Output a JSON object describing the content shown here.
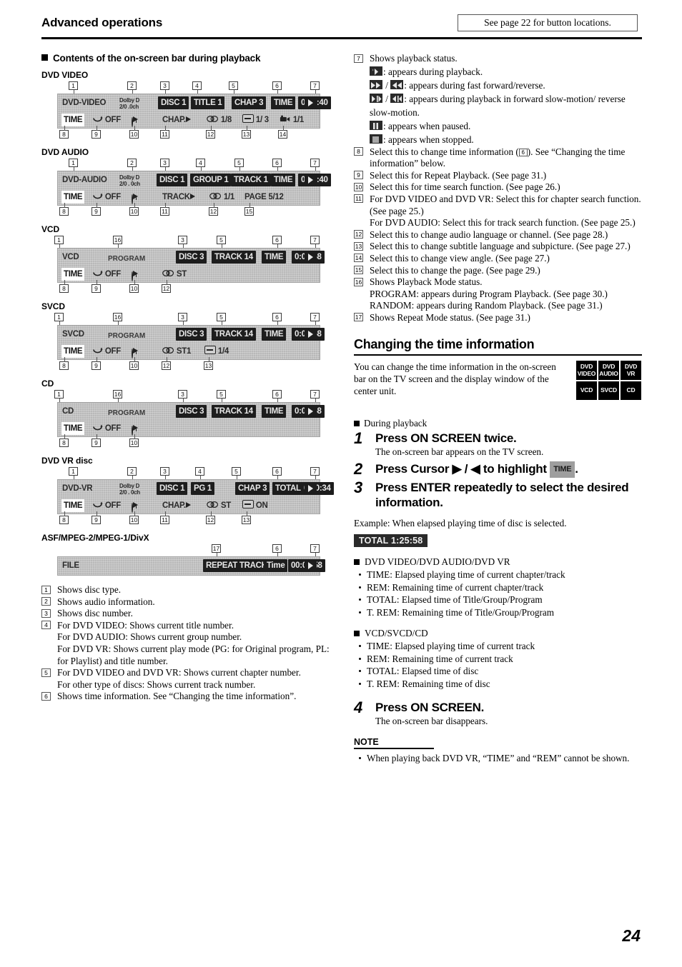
{
  "header": {
    "title": "Advanced operations",
    "note_box": "See page 22 for button locations."
  },
  "left": {
    "section_heading": "Contents of the on-screen bar during playback",
    "bars": [
      {
        "label": "DVD VIDEO",
        "row1": {
          "type": "DVD-VIDEO",
          "audio": "Dolby D\n2/0  .0ch",
          "disc": "DISC 1",
          "title": "TITLE  1",
          "chapter": "CHAP  3",
          "time_label": "TIME",
          "time_value": "0:01:40"
        },
        "row2": {
          "time": "TIME",
          "repeat": "OFF",
          "search": "CHAP.",
          "audio_ch": "1/8",
          "subtitle": "1/ 3",
          "angle": "1/1"
        }
      },
      {
        "label": "DVD AUDIO",
        "row1": {
          "type": "DVD-AUDIO",
          "audio": "Dolby D\n2/0 . 0ch",
          "disc": "DISC 1",
          "group": "GROUP 1",
          "track": "TRACK 1",
          "time_label": "TIME",
          "time_value": "0:01:40"
        },
        "row2": {
          "time": "TIME",
          "repeat": "OFF",
          "search": "TRACK",
          "audio_ch": "1/1",
          "page": "PAGE 5/12"
        }
      },
      {
        "label": "VCD",
        "row1": {
          "type": "VCD",
          "mode": "PROGRAM",
          "disc": "DISC 3",
          "track": "TRACK 14",
          "time_label": "TIME",
          "time_value": "0:04:58"
        },
        "row2": {
          "time": "TIME",
          "repeat": "OFF",
          "audio_ch": "ST"
        }
      },
      {
        "label": "SVCD",
        "row1": {
          "type": "SVCD",
          "mode": "PROGRAM",
          "disc": "DISC 3",
          "track": "TRACK 14",
          "time_label": "TIME",
          "time_value": "0:04:58"
        },
        "row2": {
          "time": "TIME",
          "repeat": "OFF",
          "audio_ch": "ST1",
          "subtitle": "1/4"
        }
      },
      {
        "label": "CD",
        "row1": {
          "type": "CD",
          "mode": "PROGRAM",
          "disc": "DISC 3",
          "track": "TRACK 14",
          "time_label": "TIME",
          "time_value": "0:04:58"
        },
        "row2": {
          "time": "TIME",
          "repeat": "OFF"
        }
      },
      {
        "label": "DVD VR disc",
        "row1": {
          "type": "DVD-VR",
          "audio": "Dolby D\n2/0 . 0ch",
          "disc": "DISC 1",
          "pg": "PG      1",
          "chapter": "CHAP  3",
          "time_label": "TOTAL",
          "time_value": "0:00:34"
        },
        "row2": {
          "time": "TIME",
          "repeat": "OFF",
          "search": "CHAP.",
          "audio_ch": "ST",
          "subtitle": "ON"
        }
      },
      {
        "label": "ASF/MPEG-2/MPEG-1/DivX",
        "row1": {
          "type": "FILE",
          "repeat_mode": "REPEAT TRACK",
          "time_label": "Time",
          "time_value": "00:04:58"
        }
      }
    ],
    "notes": [
      {
        "num": "1",
        "lines": [
          "Shows disc type."
        ]
      },
      {
        "num": "2",
        "lines": [
          "Shows audio information."
        ]
      },
      {
        "num": "3",
        "lines": [
          "Shows disc number."
        ]
      },
      {
        "num": "4",
        "lines": [
          "For DVD VIDEO: Shows current title number.",
          "For DVD AUDIO: Shows current group number.",
          "For DVD VR: Shows current play mode (PG: for Original program, PL: for Playlist) and title number."
        ]
      },
      {
        "num": "5",
        "lines": [
          "For DVD VIDEO and DVD VR: Shows current chapter number.",
          "For other type of discs: Shows current track number."
        ]
      },
      {
        "num": "6",
        "lines": [
          "Shows time information. See “Changing the time information”."
        ]
      }
    ]
  },
  "right": {
    "note7": {
      "num": "7",
      "title": "Shows playback status.",
      "status_lines": [
        {
          "icon": "play-icon",
          "text": ": appears during playback."
        },
        {
          "icon": "fast-forward-rewind-icon",
          "text": ": appears during fast forward/reverse."
        },
        {
          "icon": "slow-motion-icon",
          "text": ": appears during playback in forward slow-motion/ reverse slow-motion."
        },
        {
          "icon": "pause-icon",
          "text": ": appears when paused."
        },
        {
          "icon": "stop-icon",
          "text": ": appears when stopped."
        }
      ]
    },
    "notes": [
      {
        "num": "8",
        "lines": [
          "Select this to change time information (⓬). See “Changing the time information” below."
        ],
        "inline_num": "6"
      },
      {
        "num": "9",
        "lines": [
          "Select this for Repeat Playback. (See page 31.)"
        ]
      },
      {
        "num": "10",
        "lines": [
          "Select this for time search function. (See page 26.)"
        ]
      },
      {
        "num": "11",
        "lines": [
          "For DVD VIDEO and DVD VR: Select this for chapter search function. (See page 25.)",
          "For DVD AUDIO: Select this for track search function. (See page 25.)"
        ]
      },
      {
        "num": "12",
        "lines": [
          "Select this to change audio language or channel. (See page 28.)"
        ]
      },
      {
        "num": "13",
        "lines": [
          "Select this to change subtitle language and subpicture. (See page 27.)"
        ]
      },
      {
        "num": "14",
        "lines": [
          "Select this to change view angle. (See page 27.)"
        ]
      },
      {
        "num": "15",
        "lines": [
          "Select this to change the page. (See page 29.)"
        ]
      },
      {
        "num": "16",
        "lines": [
          "Shows Playback Mode status.",
          "PROGRAM: appears during Program Playback. (See page 30.)",
          "RANDOM: appears during Random Playback. (See page 31.)"
        ]
      },
      {
        "num": "17",
        "lines": [
          "Shows Repeat Mode status. (See page 31.)"
        ]
      }
    ],
    "section2": {
      "heading": "Changing the time information",
      "intro": "You can change the time information in the on-screen bar on the TV screen and the display window of the center unit.",
      "disc_badges": [
        [
          "DVD VIDEO",
          "DVD AUDIO",
          "DVD VR"
        ],
        [
          "VCD",
          "SVCD",
          "CD"
        ]
      ],
      "during": "During playback",
      "steps": [
        {
          "num": "1",
          "title": "Press ON SCREEN twice.",
          "desc": "The on-screen bar appears on the TV screen."
        },
        {
          "num": "2",
          "title_pre": "Press Cursor ▶ / ◀ to highlight",
          "chip": "TIME",
          "title_post": ".",
          "desc": ""
        },
        {
          "num": "3",
          "title": "Press ENTER repeatedly to select the desired information.",
          "desc": ""
        }
      ],
      "example": "Example: When elapsed playing time of disc is selected.",
      "total_chip": "TOTAL  1:25:58",
      "groups": [
        {
          "head": "DVD VIDEO/DVD AUDIO/DVD VR",
          "items": [
            "TIME: Elapsed playing time of current chapter/track",
            "REM: Remaining time of current chapter/track",
            "TOTAL: Elapsed time of Title/Group/Program",
            "T. REM: Remaining time of Title/Group/Program"
          ]
        },
        {
          "head": "VCD/SVCD/CD",
          "items": [
            "TIME: Elapsed playing time of current track",
            "REM: Remaining time of current track",
            "TOTAL: Elapsed time of disc",
            "T. REM: Remaining time of disc"
          ]
        }
      ],
      "step4": {
        "num": "4",
        "title": "Press ON SCREEN.",
        "desc": "The on-screen bar disappears."
      },
      "note_heading": "NOTE",
      "note_items": [
        "When playing back DVD VR, “TIME” and “REM” cannot be shown."
      ]
    }
  },
  "page_number": "24"
}
